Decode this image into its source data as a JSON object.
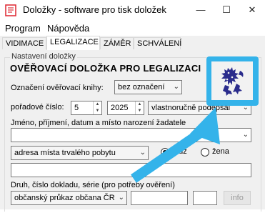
{
  "window": {
    "title": "Doložky - software pro tisk doložek",
    "minimize_glyph": "—",
    "maximize_glyph": "☐",
    "close_glyph": "✕"
  },
  "menu": {
    "items": [
      "Program",
      "Nápověda"
    ]
  },
  "tabs": [
    {
      "label": "VIDIMACE",
      "active": false
    },
    {
      "label": "LEGALIZACE",
      "active": true
    },
    {
      "label": "ZÁMĚR",
      "active": false
    },
    {
      "label": "SCHVÁLENÍ",
      "active": false
    }
  ],
  "form": {
    "group_caption": "Nastavení doložky",
    "heading": "OVĚŘOVACÍ DOLOŽKA PRO LEGALIZACI",
    "book_label": "Označení ověřovací knihy:",
    "book_value": "bez označení",
    "order_label": "pořadové číslo:",
    "order_number": "5",
    "order_year": "2025",
    "signature_mode": "vlastnoručně podepsal",
    "person_label": "Jméno, příjmení, datum a místo narození žadatele",
    "person_value": "",
    "address_type": "adresa místa trvalého pobytu",
    "gender_options": [
      "muž",
      "žena"
    ],
    "gender_selected": "muž",
    "address_value": "",
    "document_label": "Druh, číslo dokladu, série (pro potřeby ověření)",
    "document_type": "občanský průkaz občana ČR",
    "document_number": "",
    "document_series": "",
    "info_button": "info"
  },
  "colors": {
    "accent": "#34b3ea",
    "emblem": "#2b2c8c"
  },
  "icons": {
    "app": "document-icon",
    "emblem": "czech-lion-emblem",
    "pointer": "arrow-icon"
  }
}
